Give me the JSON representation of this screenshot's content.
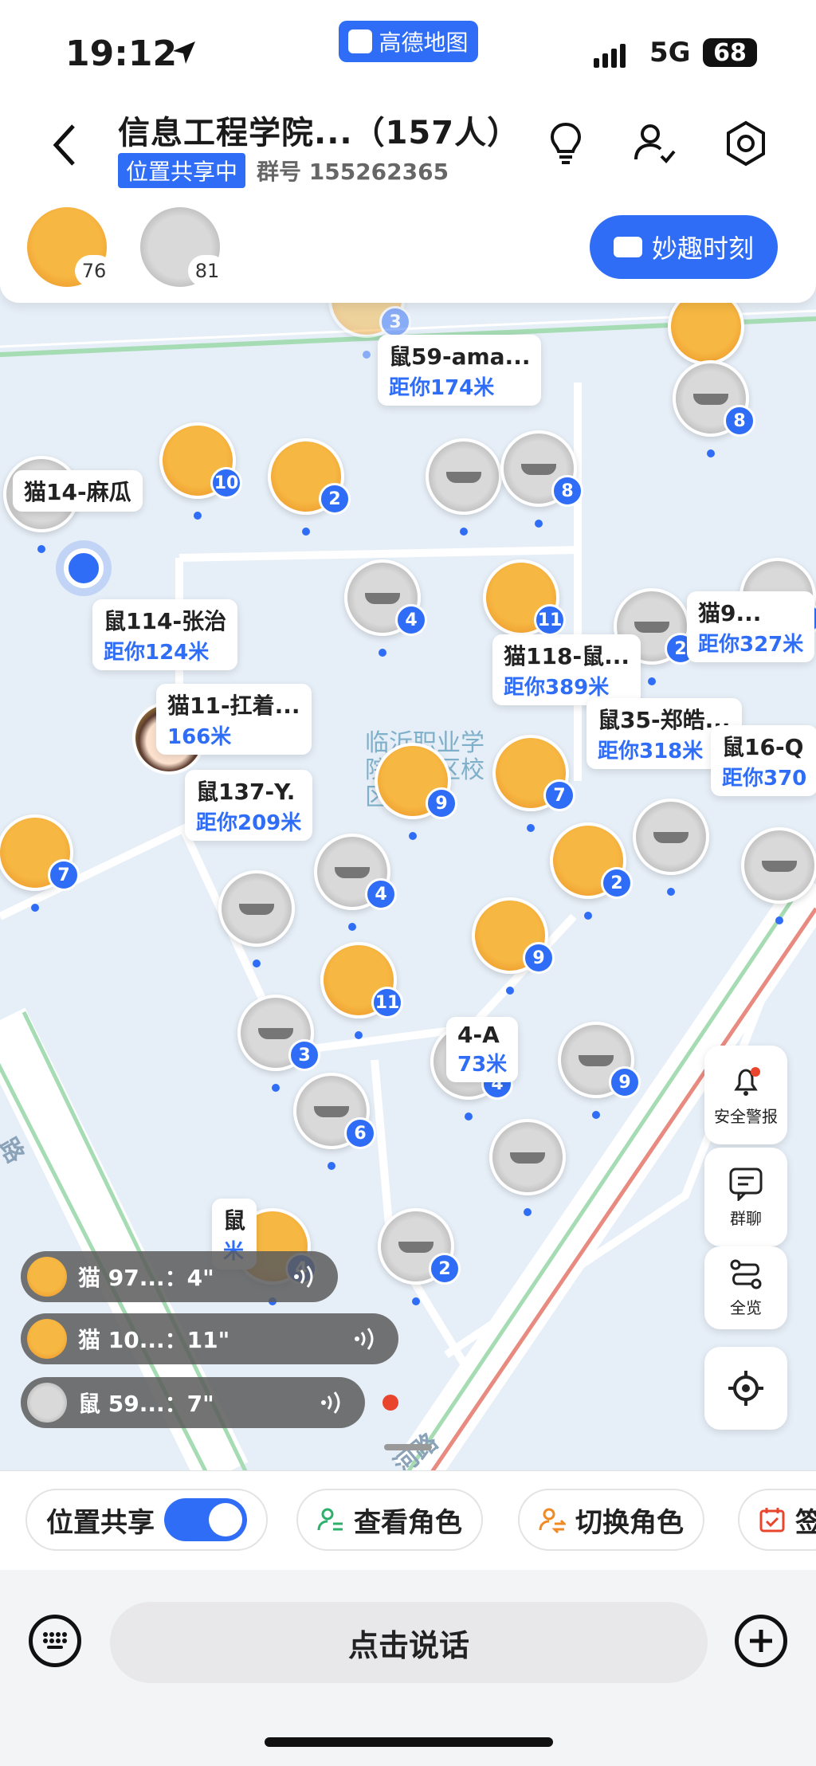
{
  "status": {
    "time": "19:12",
    "app_name": "高德地图",
    "network": "5G",
    "battery": "68"
  },
  "header": {
    "title": "信息工程学院...（157人）",
    "share_tag": "位置共享中",
    "group_number": "群号 155262365"
  },
  "members": {
    "cat_count": "76",
    "mouse_count": "81"
  },
  "moment_button": "妙趣时刻",
  "map": {
    "campus_label": "临沂职业学院开发区校区",
    "road_labels": [
      "路",
      "河路"
    ],
    "bubbles": [
      {
        "name": "鼠59-ama...",
        "dist": "距你174米"
      },
      {
        "name": "猫14-麻瓜",
        "dist": ""
      },
      {
        "name": "鼠114-张治",
        "dist": "距你124米"
      },
      {
        "name": "猫11-扛着...",
        "dist": "166米"
      },
      {
        "name": "鼠137-Y.",
        "dist": "距你209米"
      },
      {
        "name": "猫118-鼠...",
        "dist": "距你389米"
      },
      {
        "name": "鼠35-郑皓...",
        "dist": "距你318米"
      },
      {
        "name": "猫9...",
        "dist": "距你327米"
      },
      {
        "name": "鼠16-Q",
        "dist": "距你370"
      },
      {
        "name": "4-A",
        "dist": "73米"
      },
      {
        "name": "鼠",
        "dist": "米"
      }
    ],
    "badges": [
      "3",
      "8",
      "10",
      "2",
      "8",
      "4",
      "11",
      "2",
      "4",
      "9",
      "7",
      "7",
      "4",
      "2",
      "9",
      "11",
      "3",
      "6",
      "4",
      "9",
      "2",
      "4"
    ]
  },
  "side_buttons": {
    "alert": "安全警报",
    "chat": "群聊",
    "overview": "全览"
  },
  "voice_messages": [
    {
      "text": "猫 97...：4\""
    },
    {
      "text": "猫 10...：11\""
    },
    {
      "text": "鼠 59...：7\""
    }
  ],
  "toolbar": {
    "share_label": "位置共享",
    "view_role": "查看角色",
    "switch_role": "切换角色",
    "sign": "签"
  },
  "talk_button": "点击说话",
  "colors": {
    "accent": "#2f6df6",
    "cat": "#f0a030",
    "unread": "#e8452c"
  }
}
